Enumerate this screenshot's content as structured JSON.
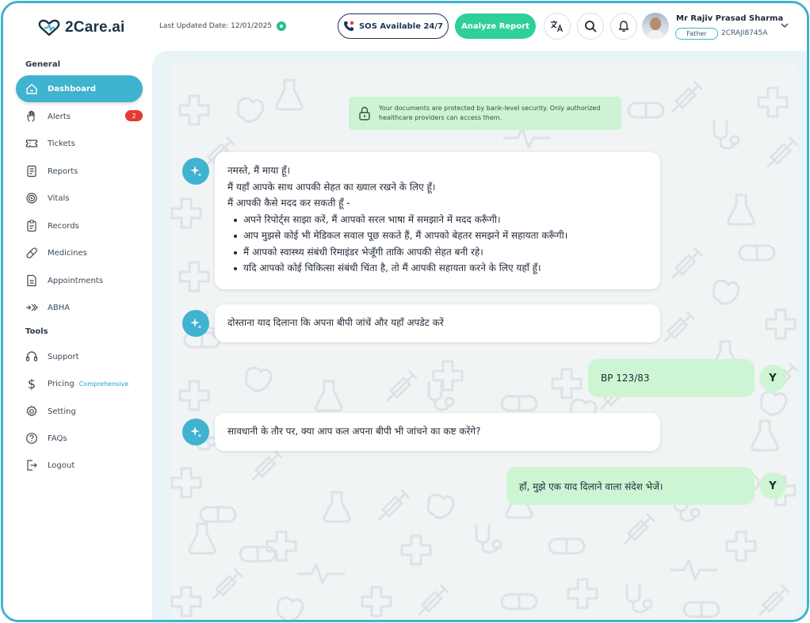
{
  "app": {
    "name": "2Care.ai"
  },
  "header": {
    "last_updated": "Last Updated Date: 12/01/2025",
    "sos_label": "SOS Available 24/7",
    "analyze_label": "Analyze Report",
    "translate_icon": "translate-icon",
    "search_icon": "search-icon",
    "bell_icon": "bell-icon",
    "user": {
      "name": "Mr Rajiv Prasad Sharma",
      "relation": "Father",
      "id": "2CRAJI8745A"
    }
  },
  "sidebar": {
    "general_title": "General",
    "tools_title": "Tools",
    "general_items": [
      {
        "label": "Dashboard",
        "icon": "home-icon",
        "active": true
      },
      {
        "label": "Alerts",
        "icon": "hand-icon",
        "badge": "2"
      },
      {
        "label": "Tickets",
        "icon": "ticket-icon"
      },
      {
        "label": "Reports",
        "icon": "report-icon"
      },
      {
        "label": "Vitals",
        "icon": "vitals-icon"
      },
      {
        "label": "Records",
        "icon": "records-icon"
      },
      {
        "label": "Medicines",
        "icon": "pill-icon"
      },
      {
        "label": "Appointments",
        "icon": "appointment-icon"
      },
      {
        "label": "ABHA",
        "icon": "abha-icon"
      }
    ],
    "tools_items": [
      {
        "label": "Support",
        "icon": "headset-icon"
      },
      {
        "label": "Pricing",
        "icon": "dollar-icon",
        "tag": "Comprehensive"
      },
      {
        "label": "Setting",
        "icon": "gear-icon"
      },
      {
        "label": "FAQs",
        "icon": "question-icon"
      },
      {
        "label": "Logout",
        "icon": "logout-icon"
      }
    ]
  },
  "chat": {
    "security_note": "Your documents are protected by bank-level security. Only authorized healthcare providers can access them.",
    "greeting": {
      "line1": "नमस्ते, मैं माया हूँ।",
      "line2": " मैं यहाँ आपके साथ आपकी सेहत का ख्याल रखने के लिए हूँ।",
      "line3": "मैं आपकी कैसे मदद कर सकती हूँ -",
      "bullets": [
        "अपने रिपोर्ट्स साझा करें, मैं आपको सरल भाषा में समझाने में मदद करूँगी।",
        "आप मुझसे कोई भी मेडिकल सवाल पूछ सकते हैं, मैं आपको बेहतर समझने में सहायता करूँगी।",
        "मैं आपको स्वास्थ्य संबंधी रिमाइंडर भेजूँगी ताकि आपकी सेहत बनी रहे।",
        "यदि आपको कोई चिकित्सा संबंधी चिंता है, तो मैं आपकी सहायता करने के लिए यहाँ हूँ।"
      ]
    },
    "bot_reminder": "दोस्ताना याद दिलाना कि अपना बीपी जांचें और यहाँ अपडेट करें",
    "user_bp": "BP 123/83",
    "bot_followup": "सावधानी के तौर पर, क्या आप कल अपना बीपी भी जांचने का कष्ट करेंगे?",
    "user_reply": "हाँ, मुझे एक याद दिलाने वाला संदेश भेजें।",
    "user_initial": "Y"
  },
  "colors": {
    "accent": "#3fb3cf",
    "success": "#2fcf9a",
    "user_bubble": "#cdf5d3",
    "alert": "#e53935"
  }
}
